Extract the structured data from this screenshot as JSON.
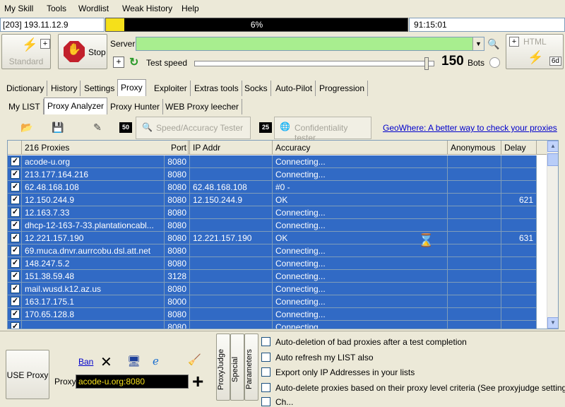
{
  "menu": [
    "My Skill",
    "Tools",
    "Wordlist",
    "Weak History",
    "Help"
  ],
  "status": {
    "ip": "[203] 193.11.12.9",
    "progress_label": "6%",
    "progress_value": 0.06,
    "time": "91:15:01"
  },
  "controls": {
    "standard_label": "Standard",
    "stop_label": "Stop",
    "server_label": "Server",
    "server_value": "",
    "test_speed_label": "Test speed",
    "html_label": "HTML",
    "sixd_label": "6d",
    "bots_value": "150",
    "bots_label": "Bots",
    "slider_value": 0.98
  },
  "tabs_main": [
    "Dictionary",
    "History",
    "Settings",
    "Proxy",
    "Exploiter",
    "Extras tools",
    "Socks",
    "Auto-Pilot",
    "Progression"
  ],
  "tabs_proxy": [
    "My LIST",
    "Proxy Analyzer",
    "Proxy Hunter",
    "WEB Proxy leecher"
  ],
  "toolbar": {
    "badge1": "50",
    "speed_tester": "Speed/Accuracy Tester",
    "badge2": "25",
    "conf_tester": "Confidentiality tester",
    "geo_link": "GeoWhere: A better way to check your proxies"
  },
  "table": {
    "headers": {
      "proxies": "216 Proxies",
      "port": "Port",
      "ip": "IP Addr",
      "accuracy": "Accuracy",
      "anonymous": "Anonymous",
      "delay": "Delay"
    },
    "rows": [
      {
        "proxy": "acode-u.org",
        "port": "8080",
        "ip": "",
        "accuracy": "Connecting...",
        "anonymous": "",
        "delay": ""
      },
      {
        "proxy": "213.177.164.216",
        "port": "8080",
        "ip": "",
        "accuracy": "Connecting...",
        "anonymous": "",
        "delay": ""
      },
      {
        "proxy": "62.48.168.108",
        "port": "8080",
        "ip": "62.48.168.108",
        "accuracy": "#0 -",
        "anonymous": "",
        "delay": ""
      },
      {
        "proxy": "12.150.244.9",
        "port": "8080",
        "ip": "12.150.244.9",
        "accuracy": "OK",
        "anonymous": "",
        "delay": "621"
      },
      {
        "proxy": "12.163.7.33",
        "port": "8080",
        "ip": "",
        "accuracy": "Connecting...",
        "anonymous": "",
        "delay": ""
      },
      {
        "proxy": "dhcp-12-163-7-33.plantationcabl...",
        "port": "8080",
        "ip": "",
        "accuracy": "Connecting...",
        "anonymous": "",
        "delay": ""
      },
      {
        "proxy": "12.221.157.190",
        "port": "8080",
        "ip": "12.221.157.190",
        "accuracy": "OK",
        "anonymous": "",
        "delay": "631"
      },
      {
        "proxy": "69.muca.dnvr.aurrcobu.dsl.att.net",
        "port": "8080",
        "ip": "",
        "accuracy": "Connecting...",
        "anonymous": "",
        "delay": ""
      },
      {
        "proxy": "148.247.5.2",
        "port": "8080",
        "ip": "",
        "accuracy": "Connecting...",
        "anonymous": "",
        "delay": ""
      },
      {
        "proxy": "151.38.59.48",
        "port": "3128",
        "ip": "",
        "accuracy": "Connecting...",
        "anonymous": "",
        "delay": ""
      },
      {
        "proxy": "mail.wusd.k12.az.us",
        "port": "8080",
        "ip": "",
        "accuracy": "Connecting...",
        "anonymous": "",
        "delay": ""
      },
      {
        "proxy": "163.17.175.1",
        "port": "8000",
        "ip": "",
        "accuracy": "Connecting...",
        "anonymous": "",
        "delay": ""
      },
      {
        "proxy": "170.65.128.8",
        "port": "8080",
        "ip": "",
        "accuracy": "Connecting...",
        "anonymous": "",
        "delay": ""
      },
      {
        "proxy": "....",
        "port": "8080",
        "ip": "",
        "accuracy": "Connecting...",
        "anonymous": "",
        "delay": ""
      }
    ]
  },
  "bottom": {
    "use_proxy": "USE Proxy",
    "ban": "Ban",
    "proxy_label": "Proxy",
    "proxy_value": "acode-u.org:8080",
    "proxyjudge": "ProxyJudge",
    "special": "Special",
    "parameters": "Parameters",
    "options": [
      "Auto-deletion of bad proxies after a test completion",
      "Auto refresh my LIST also",
      "Export only IP Addresses in your lists",
      "Auto-delete proxies based on their proxy level criteria (See proxyjudge settings)",
      "Ch..."
    ]
  }
}
